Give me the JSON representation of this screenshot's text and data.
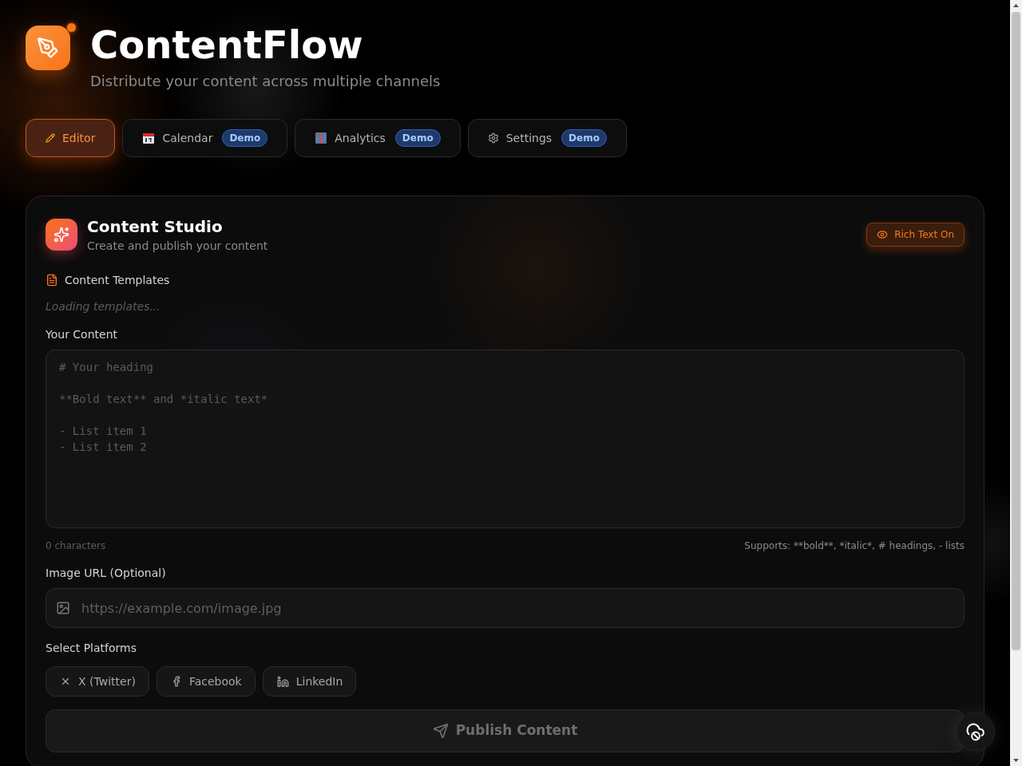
{
  "app": {
    "title": "ContentFlow",
    "subtitle": "Distribute your content across multiple channels"
  },
  "tabs": [
    {
      "kind": "editor",
      "label": "Editor",
      "selected": true
    },
    {
      "kind": "calendar",
      "label": "Calendar",
      "badge": "Demo",
      "selected": false
    },
    {
      "kind": "analytics",
      "label": "Analytics",
      "badge": "Demo",
      "selected": false
    },
    {
      "kind": "settings",
      "label": "Settings",
      "badge": "Demo",
      "selected": false
    }
  ],
  "studio": {
    "title": "Content Studio",
    "subtitle": "Create and publish your content",
    "rich_text_toggle": {
      "label": "Rich Text On",
      "on": true
    }
  },
  "templates": {
    "label": "Content Templates",
    "status": "Loading templates..."
  },
  "content": {
    "label": "Your Content",
    "placeholder": "# Your heading\n\n**Bold text** and *italic text*\n\n- List item 1\n- List item 2",
    "count": "0 characters",
    "hint": "Supports: **bold**, *italic*, # headings, - lists"
  },
  "image_url": {
    "label": "Image URL (Optional)",
    "placeholder": "https://example.com/image.jpg"
  },
  "platforms": {
    "label": "Select Platforms",
    "items": [
      {
        "kind": "x",
        "label": "X (Twitter)",
        "selected": false
      },
      {
        "kind": "facebook",
        "label": "Facebook",
        "selected": false
      },
      {
        "kind": "linkedin",
        "label": "LinkedIn",
        "selected": false
      }
    ]
  },
  "publish": {
    "label": "Publish Content",
    "disabled": true
  }
}
